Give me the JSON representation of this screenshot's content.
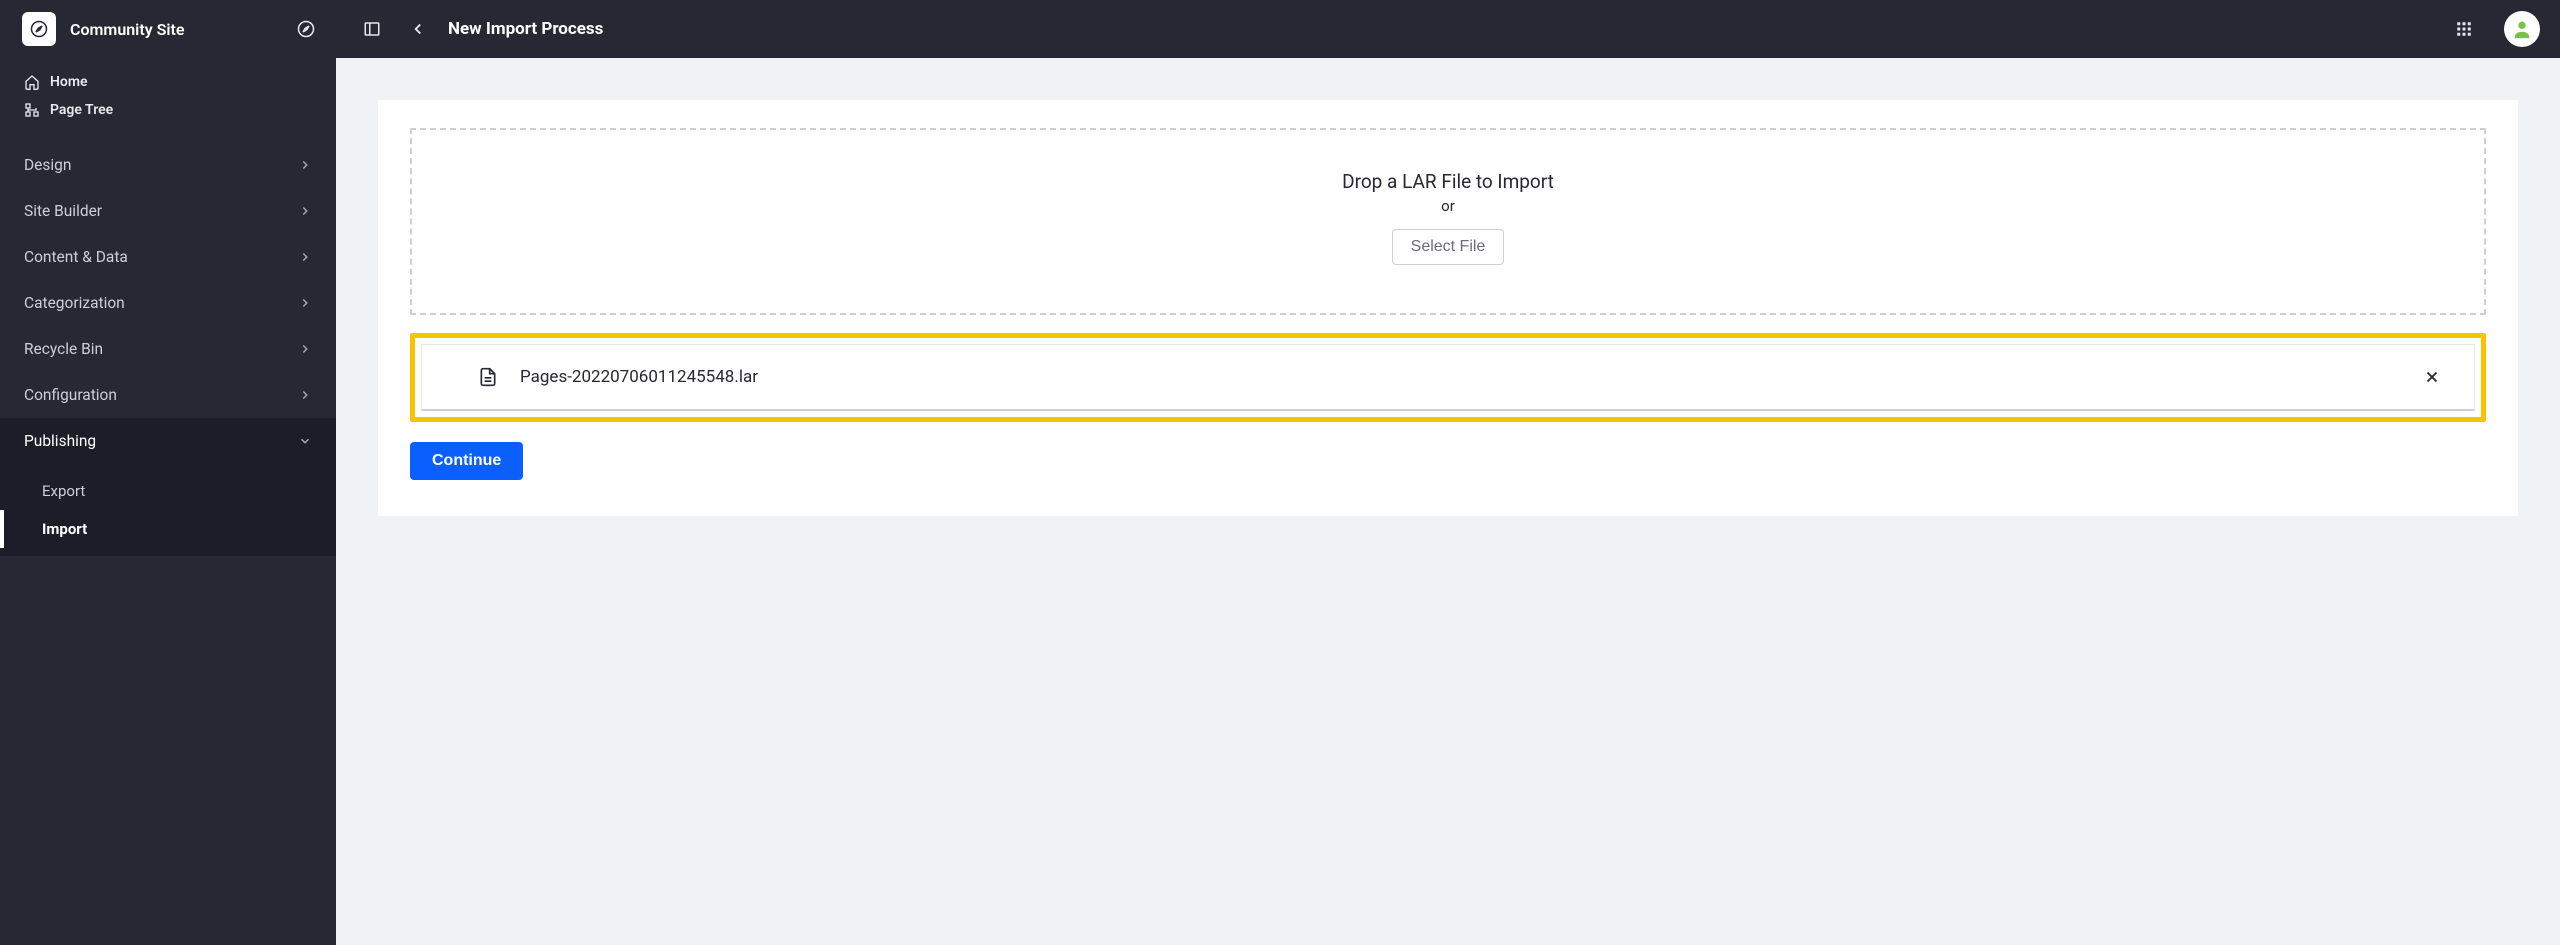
{
  "site": {
    "title": "Community Site"
  },
  "sidebar": {
    "home_label": "Home",
    "page_tree_label": "Page Tree",
    "items": [
      {
        "label": "Design"
      },
      {
        "label": "Site Builder"
      },
      {
        "label": "Content & Data"
      },
      {
        "label": "Categorization"
      },
      {
        "label": "Recycle Bin"
      },
      {
        "label": "Configuration"
      },
      {
        "label": "Publishing"
      }
    ],
    "publishing_sub": {
      "export_label": "Export",
      "import_label": "Import"
    }
  },
  "header": {
    "title": "New Import Process"
  },
  "dropzone": {
    "title": "Drop a LAR File to Import",
    "or": "or",
    "select_label": "Select File"
  },
  "file": {
    "name": "Pages-20220706011245548.lar"
  },
  "actions": {
    "continue_label": "Continue"
  }
}
